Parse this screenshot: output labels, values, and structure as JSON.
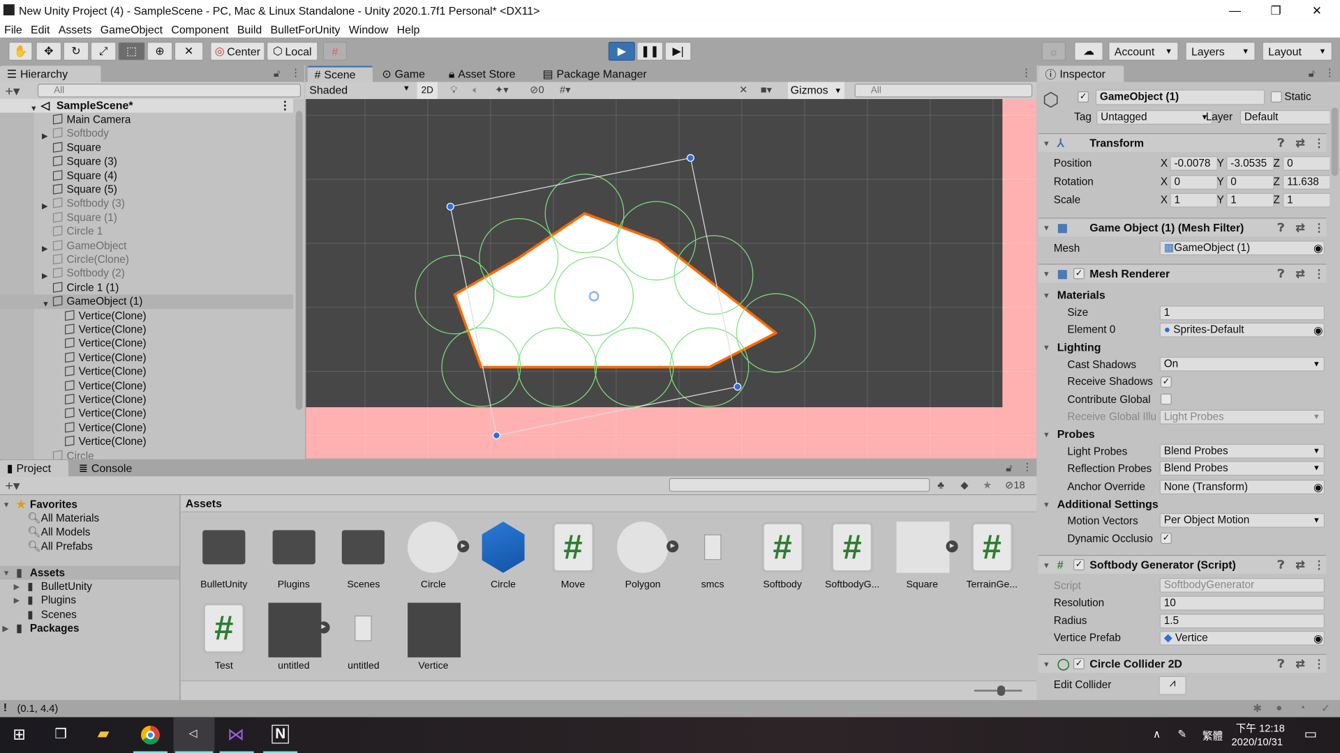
{
  "window": {
    "title": "New Unity Project (4) - SampleScene - PC, Mac & Linux Standalone - Unity 2020.1.7f1 Personal* <DX11>",
    "minimize": "—",
    "restore": "❐",
    "close": "✕"
  },
  "menu": [
    "File",
    "Edit",
    "Assets",
    "GameObject",
    "Component",
    "Build",
    "BulletForUnity",
    "Window",
    "Help"
  ],
  "toolbar": {
    "center": "Center",
    "local": "Local",
    "account": "Account",
    "layers": "Layers",
    "layout": "Layout",
    "play_state": "stopped"
  },
  "hierarchy": {
    "tab": "Hierarchy",
    "search_placeholder": "All",
    "scene": "SampleScene*",
    "items": [
      {
        "label": "Main Camera",
        "depth": 1,
        "dim": false,
        "expand": ""
      },
      {
        "label": "Softbody",
        "depth": 1,
        "dim": true,
        "expand": "▶"
      },
      {
        "label": "Square",
        "depth": 1,
        "dim": false,
        "expand": ""
      },
      {
        "label": "Square (3)",
        "depth": 1,
        "dim": false,
        "expand": ""
      },
      {
        "label": "Square (4)",
        "depth": 1,
        "dim": false,
        "expand": ""
      },
      {
        "label": "Square (5)",
        "depth": 1,
        "dim": false,
        "expand": ""
      },
      {
        "label": "Softbody (3)",
        "depth": 1,
        "dim": true,
        "expand": "▶"
      },
      {
        "label": "Square (1)",
        "depth": 1,
        "dim": true,
        "expand": ""
      },
      {
        "label": "Circle 1",
        "depth": 1,
        "dim": true,
        "expand": ""
      },
      {
        "label": "GameObject",
        "depth": 1,
        "dim": true,
        "expand": "▶"
      },
      {
        "label": "Circle(Clone)",
        "depth": 1,
        "dim": true,
        "expand": ""
      },
      {
        "label": "Softbody (2)",
        "depth": 1,
        "dim": true,
        "expand": "▶"
      },
      {
        "label": "Circle 1 (1)",
        "depth": 1,
        "dim": false,
        "expand": ""
      },
      {
        "label": "GameObject (1)",
        "depth": 1,
        "dim": false,
        "expand": "▼",
        "selected": true
      },
      {
        "label": "Vertice(Clone)",
        "depth": 2,
        "dim": false,
        "expand": ""
      },
      {
        "label": "Vertice(Clone)",
        "depth": 2,
        "dim": false,
        "expand": ""
      },
      {
        "label": "Vertice(Clone)",
        "depth": 2,
        "dim": false,
        "expand": ""
      },
      {
        "label": "Vertice(Clone)",
        "depth": 2,
        "dim": false,
        "expand": ""
      },
      {
        "label": "Vertice(Clone)",
        "depth": 2,
        "dim": false,
        "expand": ""
      },
      {
        "label": "Vertice(Clone)",
        "depth": 2,
        "dim": false,
        "expand": ""
      },
      {
        "label": "Vertice(Clone)",
        "depth": 2,
        "dim": false,
        "expand": ""
      },
      {
        "label": "Vertice(Clone)",
        "depth": 2,
        "dim": false,
        "expand": ""
      },
      {
        "label": "Vertice(Clone)",
        "depth": 2,
        "dim": false,
        "expand": ""
      },
      {
        "label": "Vertice(Clone)",
        "depth": 2,
        "dim": false,
        "expand": ""
      },
      {
        "label": "Circle",
        "depth": 1,
        "dim": true,
        "expand": ""
      }
    ]
  },
  "scene": {
    "tabs": [
      "Scene",
      "Game",
      "Asset Store",
      "Package Manager"
    ],
    "shading": "Shaded",
    "mode_2d": "2D",
    "hidden_count": "0",
    "gizmos": "Gizmos",
    "search_placeholder": "All",
    "colors": {
      "background": "#474747",
      "pink": "#ffb1b1",
      "fill": "#ffffff",
      "outline": "#ff6a00",
      "collider": "#7be07b",
      "handle": "#2f6fd8"
    }
  },
  "inspector": {
    "tab": "Inspector",
    "object_name": "GameObject (1)",
    "static": "Static",
    "tag_label": "Tag",
    "tag": "Untagged",
    "layer_label": "Layer",
    "layer": "Default",
    "transform": {
      "title": "Transform",
      "rows": [
        {
          "label": "Position",
          "x": "-0.0078",
          "y": "-3.0535",
          "z": "0"
        },
        {
          "label": "Rotation",
          "x": "0",
          "y": "0",
          "z": "11.638"
        },
        {
          "label": "Scale",
          "x": "1",
          "y": "1",
          "z": "1"
        }
      ]
    },
    "mesh_filter": {
      "title": "Game Object (1) (Mesh Filter)",
      "mesh_label": "Mesh",
      "mesh": "GameObject (1)"
    },
    "mesh_renderer": {
      "title": "Mesh Renderer",
      "materials": "Materials",
      "size_label": "Size",
      "size": "1",
      "element0_label": "Element 0",
      "element0": "Sprites-Default",
      "lighting": "Lighting",
      "cast_shadows_label": "Cast Shadows",
      "cast_shadows": "On",
      "receive_shadows_label": "Receive Shadows",
      "receive_shadows": true,
      "contribute_global_label": "Contribute Global",
      "contribute_global": false,
      "receive_gi_label": "Receive Global Illu",
      "receive_gi": "Light Probes",
      "probes": "Probes",
      "light_probes_label": "Light Probes",
      "light_probes": "Blend Probes",
      "reflection_probes_label": "Reflection Probes",
      "reflection_probes": "Blend Probes",
      "anchor_override_label": "Anchor Override",
      "anchor_override": "None (Transform)",
      "additional": "Additional Settings",
      "motion_vectors_label": "Motion Vectors",
      "motion_vectors": "Per Object Motion",
      "dynamic_occlusion_label": "Dynamic Occlusio",
      "dynamic_occlusion": true
    },
    "softbody": {
      "title": "Softbody Generator (Script)",
      "script_label": "Script",
      "script": "SoftbodyGenerator",
      "resolution_label": "Resolution",
      "resolution": "10",
      "radius_label": "Radius",
      "radius": "1.5",
      "prefab_label": "Vertice Prefab",
      "prefab": "Vertice"
    },
    "collider": {
      "title": "Circle Collider 2D",
      "edit_label": "Edit Collider"
    }
  },
  "project": {
    "tabs": [
      "Project",
      "Console"
    ],
    "hidden_count": "18",
    "favorites": "Favorites",
    "fav_items": [
      "All Materials",
      "All Models",
      "All Prefabs"
    ],
    "assets_root": "Assets",
    "folders": [
      "BulletUnity",
      "Plugins",
      "Scenes"
    ],
    "packages": "Packages",
    "breadcrumb": "Assets",
    "assets": [
      {
        "label": "BulletUnity",
        "kind": "folder"
      },
      {
        "label": "Plugins",
        "kind": "folder"
      },
      {
        "label": "Scenes",
        "kind": "folder"
      },
      {
        "label": "Circle",
        "kind": "sprite-circle"
      },
      {
        "label": "Circle",
        "kind": "prefab"
      },
      {
        "label": "Move",
        "kind": "script"
      },
      {
        "label": "Polygon",
        "kind": "sprite-circle"
      },
      {
        "label": "smcs",
        "kind": "file"
      },
      {
        "label": "Softbody",
        "kind": "script"
      },
      {
        "label": "SoftbodyG...",
        "kind": "script"
      },
      {
        "label": "Square",
        "kind": "sprite-square"
      },
      {
        "label": "TerrainGe...",
        "kind": "script"
      },
      {
        "label": "Test",
        "kind": "script"
      },
      {
        "label": "untitled",
        "kind": "dark-sprite"
      },
      {
        "label": "untitled",
        "kind": "file"
      },
      {
        "label": "Vertice",
        "kind": "dark"
      }
    ]
  },
  "status": {
    "message": "(0.1, 4.4)"
  },
  "taskbar": {
    "ime": "繁體",
    "time": "下午 12:18",
    "date": "2020/10/31"
  }
}
